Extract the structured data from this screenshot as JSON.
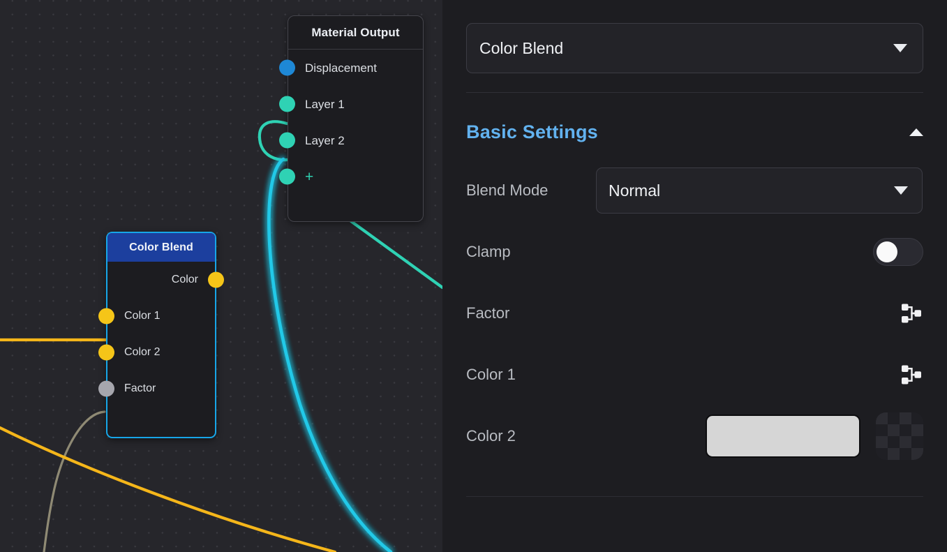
{
  "canvas": {
    "nodes": [
      {
        "id": "material-output",
        "title": "Material Output",
        "ports": [
          {
            "label": "Displacement",
            "color": "#1e88d6"
          },
          {
            "label": "Layer 1",
            "color": "#2fd2b4"
          },
          {
            "label": "Layer 2",
            "color": "#2fd2b4"
          },
          {
            "label": "+",
            "color": "#2fd2b4"
          }
        ]
      },
      {
        "id": "color-blend",
        "title": "Color Blend",
        "header_color": "#1c3f9e",
        "border_color": "#17a6e8",
        "outputs": [
          {
            "label": "Color",
            "color": "#f5c518"
          }
        ],
        "inputs": [
          {
            "label": "Color 1",
            "color": "#f5c518"
          },
          {
            "label": "Color 2",
            "color": "#f5c518"
          },
          {
            "label": "Factor",
            "color": "#a6a6ad"
          }
        ]
      }
    ],
    "wire_colors": {
      "teal": "#2fd2b4",
      "cyan": "#22c9e8",
      "amber": "#f5b61a",
      "gray": "#8f8a74"
    }
  },
  "panel": {
    "node_selector": {
      "value": "Color Blend",
      "caret": "chevron-down-icon"
    },
    "section": {
      "title": "Basic Settings",
      "title_color": "#62b2ef",
      "collapse_caret": "chevron-up-icon"
    },
    "properties": [
      {
        "label": "Blend Mode",
        "type": "select",
        "value": "Normal"
      },
      {
        "label": "Clamp",
        "type": "toggle",
        "value": "off"
      },
      {
        "label": "Factor",
        "type": "linked",
        "icon": "node-link-icon"
      },
      {
        "label": "Color 1",
        "type": "linked",
        "icon": "node-link-icon"
      },
      {
        "label": "Color 2",
        "type": "color",
        "swatch": "#d6d6d6"
      }
    ]
  }
}
